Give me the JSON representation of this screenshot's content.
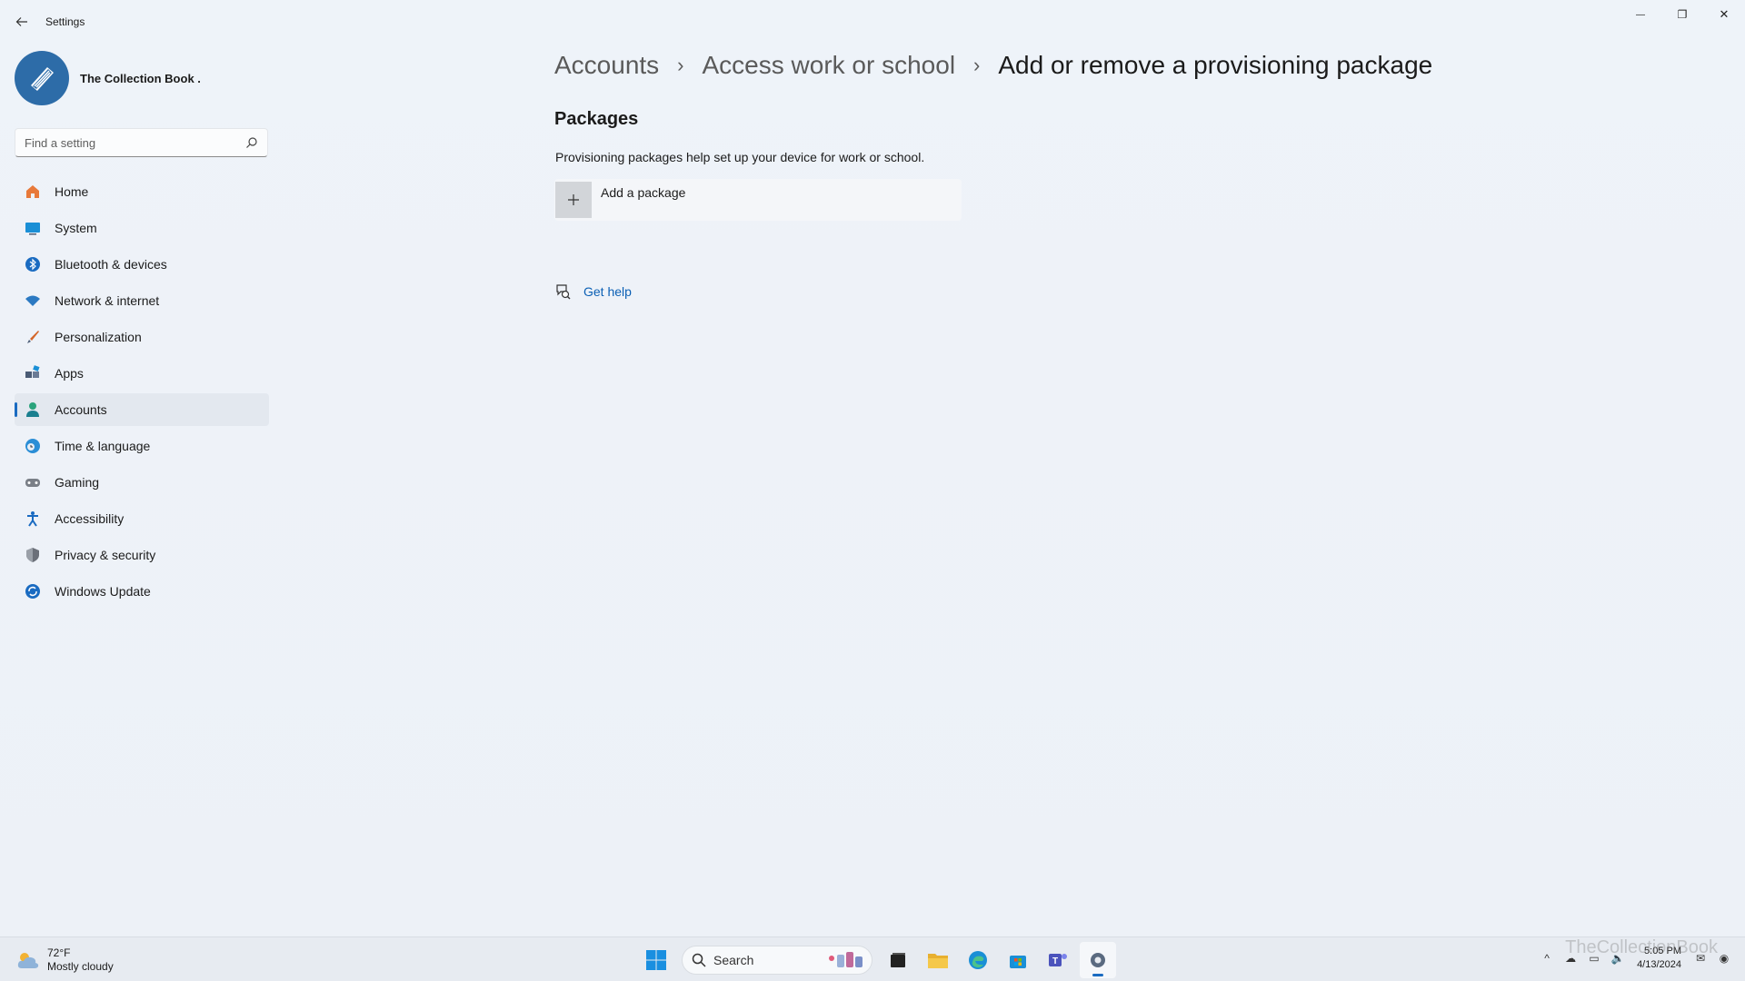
{
  "window": {
    "title": "Settings",
    "controls": {
      "minimize": "—",
      "restore": "❐",
      "close": "✕"
    }
  },
  "profile": {
    "name": "The Collection Book ."
  },
  "search": {
    "placeholder": "Find a setting"
  },
  "sidebar": {
    "items": [
      {
        "label": "Home",
        "icon": "home-icon",
        "color": "#e8793a"
      },
      {
        "label": "System",
        "icon": "system-icon",
        "color": "#1a8fd6"
      },
      {
        "label": "Bluetooth & devices",
        "icon": "bluetooth-icon",
        "color": "#1a6bc1"
      },
      {
        "label": "Network & internet",
        "icon": "wifi-icon",
        "color": "#2b79c2"
      },
      {
        "label": "Personalization",
        "icon": "brush-icon",
        "color": "#d4662a"
      },
      {
        "label": "Apps",
        "icon": "apps-icon",
        "color": "#4a5b75"
      },
      {
        "label": "Accounts",
        "icon": "person-icon",
        "color": "#2aa37c",
        "active": true
      },
      {
        "label": "Time & language",
        "icon": "globe-clock-icon",
        "color": "#2b8ed6"
      },
      {
        "label": "Gaming",
        "icon": "controller-icon",
        "color": "#7a7f87"
      },
      {
        "label": "Accessibility",
        "icon": "accessibility-icon",
        "color": "#1a6bc1"
      },
      {
        "label": "Privacy & security",
        "icon": "shield-icon",
        "color": "#6b7079"
      },
      {
        "label": "Windows Update",
        "icon": "update-icon",
        "color": "#1a6bc1"
      }
    ]
  },
  "main": {
    "breadcrumb": [
      "Accounts",
      "Access work or school",
      "Add or remove a provisioning package"
    ],
    "section_title": "Packages",
    "description": "Provisioning packages help set up your device for work or school.",
    "add_package_label": "Add a package",
    "get_help_label": "Get help"
  },
  "taskbar": {
    "weather_temp": "72°F",
    "weather_desc": "Mostly cloudy",
    "search_label": "Search",
    "time": "5:05 PM",
    "date": "4/13/2024"
  },
  "watermark": "TheCollectionBook",
  "colors": {
    "accent": "#1a6bc1",
    "link": "#0a5fb4",
    "background": "#eef2f8"
  }
}
